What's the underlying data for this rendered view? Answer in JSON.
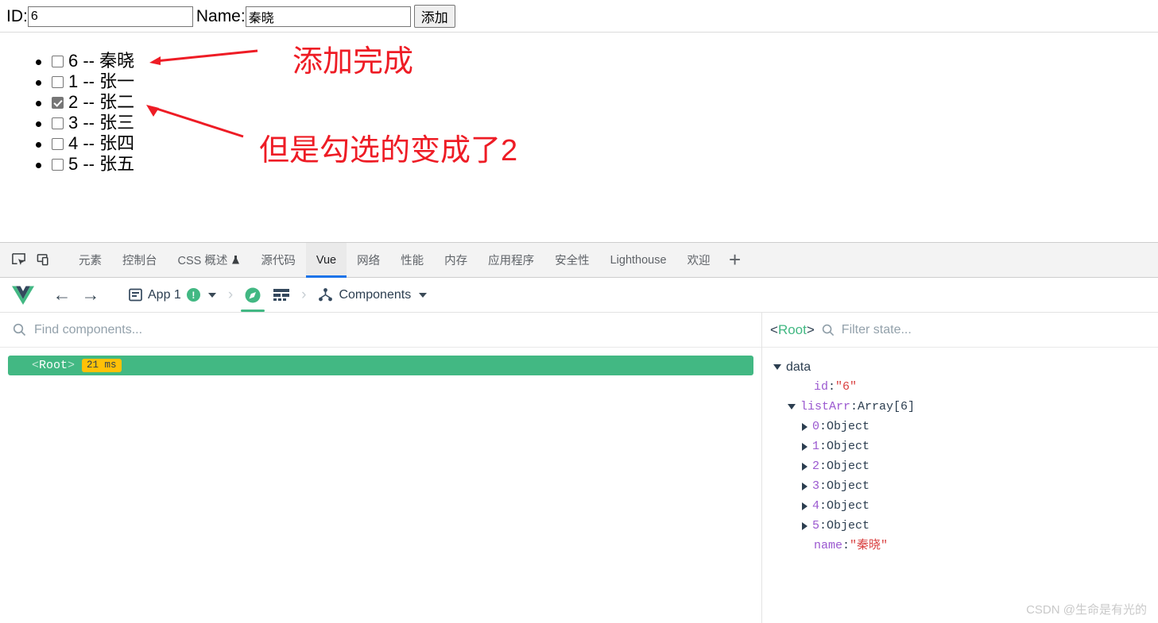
{
  "page": {
    "id_label": "ID:",
    "id_value": "6",
    "name_label": "Name:",
    "name_value": "秦晓",
    "add_button": "添加",
    "items": [
      {
        "checked": false,
        "text": "6 -- 秦晓"
      },
      {
        "checked": false,
        "text": "1 -- 张一"
      },
      {
        "checked": true,
        "text": "2 -- 张二"
      },
      {
        "checked": false,
        "text": "3 -- 张三"
      },
      {
        "checked": false,
        "text": "4 -- 张四"
      },
      {
        "checked": false,
        "text": "5 -- 张五"
      }
    ],
    "annotations": [
      {
        "text": "添加完成"
      },
      {
        "text": "但是勾选的变成了2"
      }
    ],
    "annotation_color": "#ee1c25"
  },
  "devtools": {
    "tabs": [
      {
        "label": "元素",
        "active": false
      },
      {
        "label": "控制台",
        "active": false
      },
      {
        "label": "CSS 概述",
        "active": false,
        "icon": "flask-icon"
      },
      {
        "label": "源代码",
        "active": false
      },
      {
        "label": "Vue",
        "active": true
      },
      {
        "label": "网络",
        "active": false
      },
      {
        "label": "性能",
        "active": false
      },
      {
        "label": "内存",
        "active": false
      },
      {
        "label": "应用程序",
        "active": false
      },
      {
        "label": "安全性",
        "active": false
      },
      {
        "label": "Lighthouse",
        "active": false
      },
      {
        "label": "欢迎",
        "active": false
      }
    ],
    "more_tabs_label": "+",
    "accent_color": "#1a73e8"
  },
  "vue_panel": {
    "app_selector": "App 1",
    "app_badge": "!",
    "view_selector": "Components",
    "brand_color": "#42b883",
    "search": {
      "placeholder": "Find components..."
    },
    "tree": {
      "root_open": "<",
      "root_name": "Root",
      "root_close": ">",
      "timing": "21 ms"
    },
    "state": {
      "root_open": "<",
      "root_name": "Root",
      "root_close": ">",
      "filter_placeholder": "Filter state...",
      "section": "data",
      "rows": [
        {
          "indent": 1,
          "toggle": "none",
          "key": "id",
          "sep": ": ",
          "value": "\"6\"",
          "value_type": "string"
        },
        {
          "indent": 1,
          "toggle": "down",
          "key": "listArr",
          "sep": ": ",
          "value": "Array[6]",
          "value_type": "type"
        },
        {
          "indent": 2,
          "toggle": "right",
          "key": "0",
          "sep": ": ",
          "value": "Object",
          "value_type": "type"
        },
        {
          "indent": 2,
          "toggle": "right",
          "key": "1",
          "sep": ": ",
          "value": "Object",
          "value_type": "type"
        },
        {
          "indent": 2,
          "toggle": "right",
          "key": "2",
          "sep": ": ",
          "value": "Object",
          "value_type": "type"
        },
        {
          "indent": 2,
          "toggle": "right",
          "key": "3",
          "sep": ": ",
          "value": "Object",
          "value_type": "type"
        },
        {
          "indent": 2,
          "toggle": "right",
          "key": "4",
          "sep": ": ",
          "value": "Object",
          "value_type": "type"
        },
        {
          "indent": 2,
          "toggle": "right",
          "key": "5",
          "sep": ": ",
          "value": "Object",
          "value_type": "type"
        },
        {
          "indent": 1,
          "toggle": "none",
          "key": "name",
          "sep": ": ",
          "value": "\"秦晓\"",
          "value_type": "string"
        }
      ]
    }
  },
  "watermark": "CSDN @生命是有光的"
}
